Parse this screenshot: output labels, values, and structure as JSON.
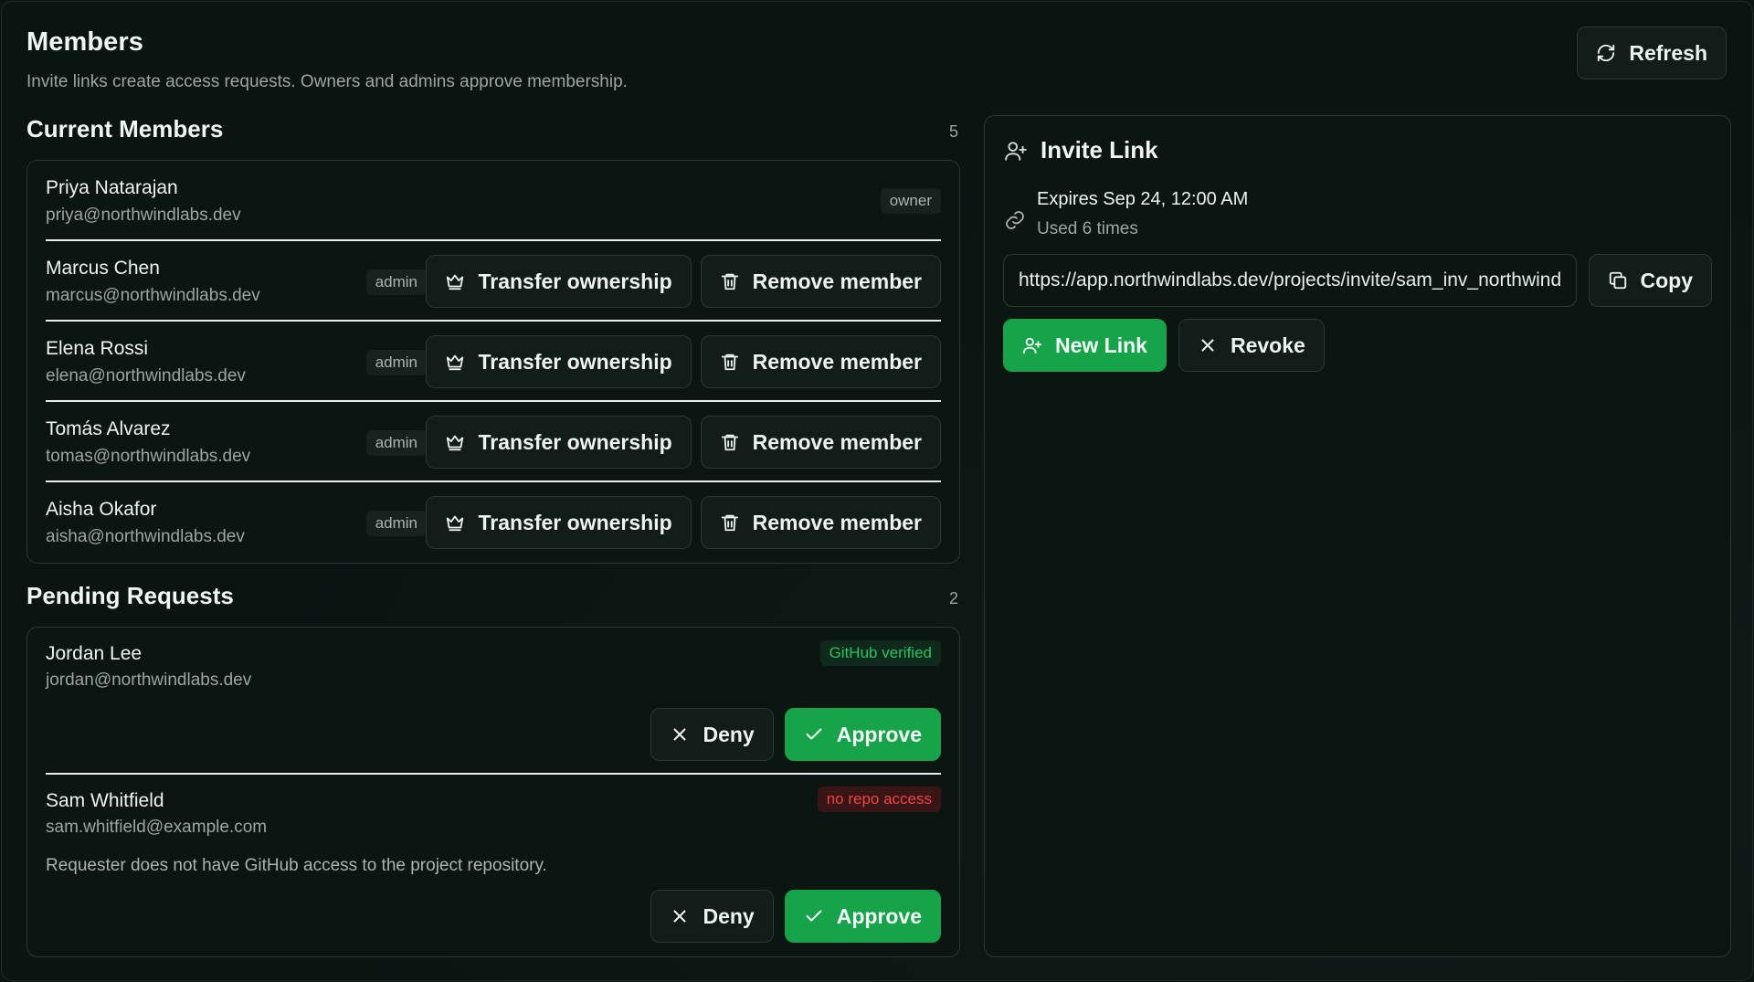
{
  "header": {
    "title": "Members",
    "subtitle": "Invite links create access requests. Owners and admins approve membership.",
    "refresh_label": "Refresh"
  },
  "current_members": {
    "title": "Current Members",
    "count": "5",
    "transfer_label": "Transfer ownership",
    "remove_label": "Remove member",
    "rows": [
      {
        "name": "Priya Natarajan",
        "email": "priya@northwindlabs.dev",
        "role": "owner"
      },
      {
        "name": "Marcus Chen",
        "email": "marcus@northwindlabs.dev",
        "role": "admin"
      },
      {
        "name": "Elena Rossi",
        "email": "elena@northwindlabs.dev",
        "role": "admin"
      },
      {
        "name": "Tomás Alvarez",
        "email": "tomas@northwindlabs.dev",
        "role": "admin"
      },
      {
        "name": "Aisha Okafor",
        "email": "aisha@northwindlabs.dev",
        "role": "admin"
      }
    ]
  },
  "pending_requests": {
    "title": "Pending Requests",
    "count": "2",
    "deny_label": "Deny",
    "approve_label": "Approve",
    "rows": [
      {
        "name": "Jordan Lee",
        "email": "jordan@northwindlabs.dev",
        "badge": "GitHub verified",
        "note": ""
      },
      {
        "name": "Sam Whitfield",
        "email": "sam.whitfield@example.com",
        "badge": "no repo access",
        "note": "Requester does not have GitHub access to the project repository."
      }
    ]
  },
  "invite": {
    "title": "Invite Link",
    "expires": "Expires Sep 24, 12:00 AM",
    "used": "Used 6 times",
    "url": "https://app.northwindlabs.dev/projects/invite/sam_inv_northwind",
    "copy_label": "Copy",
    "new_link_label": "New Link",
    "revoke_label": "Revoke"
  },
  "colors": {
    "background": "#0a1411",
    "accent_green": "#17a34a",
    "verified_text": "#22c55e",
    "error_text": "#ef4444"
  },
  "icons": [
    "refresh-icon",
    "crown-icon",
    "trash-icon",
    "x-icon",
    "check-icon",
    "user-plus-icon",
    "link-icon",
    "copy-icon"
  ]
}
